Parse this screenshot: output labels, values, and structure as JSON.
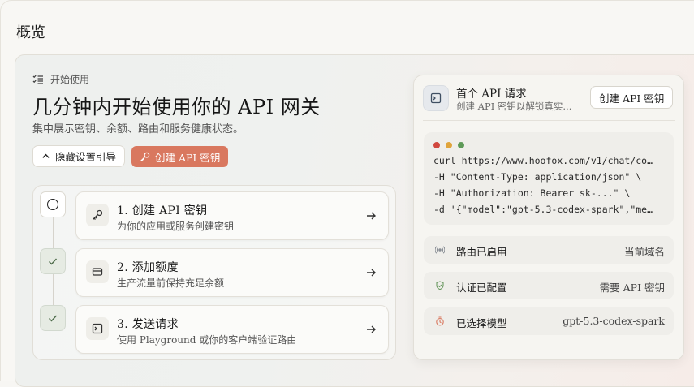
{
  "page": {
    "title": "概览"
  },
  "hero": {
    "eyebrow": "开始使用",
    "headline": "几分钟内开始使用你的 API 网关",
    "subline": "集中展示密钥、余额、路由和服务健康状态。",
    "hide_button": "隐藏设置引导",
    "create_button": "创建 API 密钥"
  },
  "steps": [
    {
      "title": "1. 创建 API 密钥",
      "desc": "为你的应用或服务创建密钥",
      "state": "current",
      "icon": "key-icon"
    },
    {
      "title": "2. 添加额度",
      "desc": "生产流量前保持充足余额",
      "state": "done",
      "icon": "card-icon"
    },
    {
      "title": "3. 发送请求",
      "desc": "使用 Playground 或你的客户端验证路由",
      "state": "done",
      "icon": "terminal-icon"
    }
  ],
  "request_card": {
    "title": "首个 API 请求",
    "subtitle": "创建 API 密钥以解锁真实...",
    "button": "创建 API 密钥",
    "code": [
      "curl https://www.hoofox.com/v1/chat/co…",
      "-H \"Content-Type: application/json\" \\",
      "-H \"Authorization: Bearer sk-...\" \\",
      "-d '{\"model\":\"gpt-5.3-codex-spark\",\"me…"
    ],
    "status": [
      {
        "label": "路由已启用",
        "value": "当前域名",
        "icon": "signal-icon",
        "color": "#8a8f96"
      },
      {
        "label": "认证已配置",
        "value": "需要 API 密钥",
        "icon": "shield-check-icon",
        "color": "#6c9a62"
      },
      {
        "label": "已选择模型",
        "value": "gpt-5.3-codex-spark",
        "icon": "timer-icon",
        "color": "#d9785f"
      }
    ]
  },
  "colors": {
    "accent": "#d9785f",
    "dot_red": "#d1483f",
    "dot_yellow": "#e0a43b",
    "dot_green": "#5e9a58"
  }
}
